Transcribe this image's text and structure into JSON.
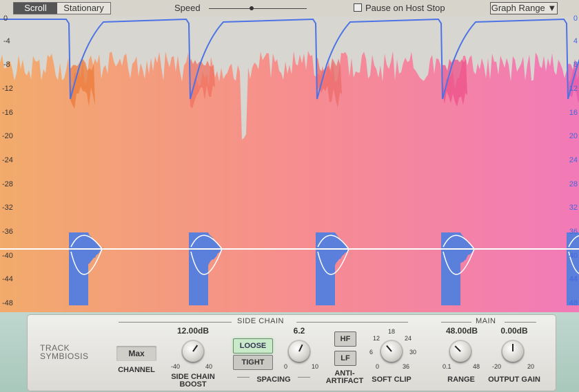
{
  "topbar": {
    "mode_tabs": [
      "Scroll",
      "Stationary"
    ],
    "speed_label": "Speed",
    "pause_label": "Pause on Host Stop",
    "graph_range_label": "Graph Range ▼"
  },
  "graph": {
    "left_axis": [
      "0",
      "-4",
      "-8",
      "-12",
      "-16",
      "-20",
      "-24",
      "-28",
      "-32",
      "-36",
      "-40",
      "-44",
      "-48"
    ],
    "right_axis": [
      "0",
      "4",
      "8",
      "12",
      "16",
      "20",
      "24",
      "28",
      "32",
      "36",
      "40",
      "44",
      "48"
    ]
  },
  "panel": {
    "brand_line1": "TRACK",
    "brand_line2": "SYMBIOSIS",
    "channel_value": "Max",
    "channel_label": "CHANNEL",
    "side_chain_section": "SIDE CHAIN",
    "main_section": "MAIN",
    "sc_boost": {
      "value": "12.00dB",
      "label1": "SIDE CHAIN",
      "label2": "BOOST",
      "min": "-40",
      "max": "40"
    },
    "spacing": {
      "value": "6.2",
      "label": "SPACING",
      "min": "0",
      "max": "10",
      "loose": "LOOSE",
      "tight": "TIGHT"
    },
    "anti_artifact": {
      "hf": "HF",
      "lf": "LF",
      "label1": "ANTI-",
      "label2": "ARTIFACT"
    },
    "soft_clip": {
      "label": "SOFT CLIP",
      "ticks": [
        "12",
        "18",
        "24",
        "6",
        "30",
        "0",
        "36"
      ]
    },
    "range": {
      "value": "48.00dB",
      "label": "RANGE",
      "min": "0.1",
      "max": "48"
    },
    "output_gain": {
      "value": "0.00dB",
      "label": "OUTPUT GAIN",
      "min": "-20",
      "max": "20"
    }
  }
}
